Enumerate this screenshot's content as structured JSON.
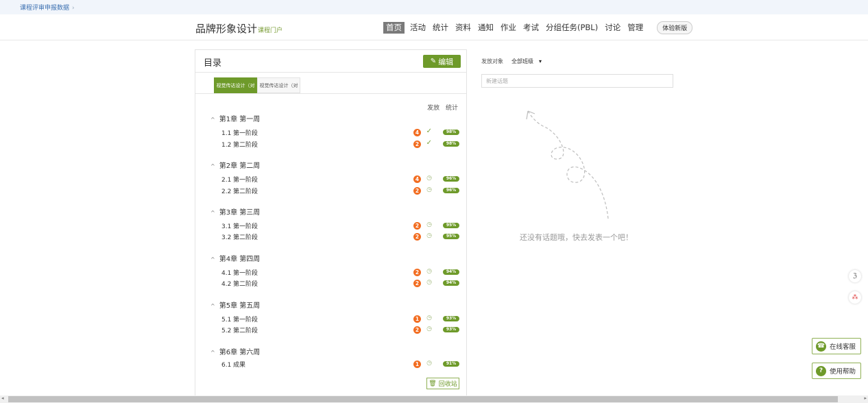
{
  "breadcrumb": {
    "label": "课程评审申报数据",
    "chevron": "›"
  },
  "header": {
    "course_title": "品牌形象设计",
    "portal_link": "课程门户",
    "nav": [
      {
        "label": "首页",
        "active": true
      },
      {
        "label": "活动"
      },
      {
        "label": "统计"
      },
      {
        "label": "资料"
      },
      {
        "label": "通知"
      },
      {
        "label": "作业"
      },
      {
        "label": "考试"
      },
      {
        "label": "分组任务(PBL)"
      },
      {
        "label": "讨论"
      },
      {
        "label": "管理"
      }
    ],
    "new_version": "体验新版"
  },
  "catalog": {
    "title": "目录",
    "edit_label": "编辑",
    "tabs": [
      "视觉传达设计（对",
      "视觉传达设计（对"
    ],
    "col_publish": "发放",
    "col_stats": "统计",
    "chapters": [
      {
        "title": "第1章 第一周",
        "sections": [
          {
            "num": "1.1",
            "name": "第一阶段",
            "badge": "4",
            "status": "check",
            "pct": "98%"
          },
          {
            "num": "1.2",
            "name": "第二阶段",
            "badge": "2",
            "status": "check",
            "pct": "98%"
          }
        ]
      },
      {
        "title": "第2章 第二周",
        "sections": [
          {
            "num": "2.1",
            "name": "第一阶段",
            "badge": "4",
            "status": "clock",
            "pct": "96%"
          },
          {
            "num": "2.2",
            "name": "第二阶段",
            "badge": "2",
            "status": "clock",
            "pct": "96%"
          }
        ]
      },
      {
        "title": "第3章 第三周",
        "sections": [
          {
            "num": "3.1",
            "name": "第一阶段",
            "badge": "2",
            "status": "clock",
            "pct": "95%"
          },
          {
            "num": "3.2",
            "name": "第二阶段",
            "badge": "2",
            "status": "clock",
            "pct": "95%"
          }
        ]
      },
      {
        "title": "第4章 第四周",
        "sections": [
          {
            "num": "4.1",
            "name": "第一阶段",
            "badge": "2",
            "status": "clock",
            "pct": "94%"
          },
          {
            "num": "4.2",
            "name": "第二阶段",
            "badge": "2",
            "status": "clock",
            "pct": "94%"
          }
        ]
      },
      {
        "title": "第5章 第五周",
        "sections": [
          {
            "num": "5.1",
            "name": "第一阶段",
            "badge": "1",
            "status": "clock",
            "pct": "93%"
          },
          {
            "num": "5.2",
            "name": "第二阶段",
            "badge": "2",
            "status": "clock",
            "pct": "93%"
          }
        ]
      },
      {
        "title": "第6章 第六周",
        "sections": [
          {
            "num": "6.1",
            "name": "成果",
            "badge": "1",
            "status": "clock",
            "pct": "91%"
          }
        ]
      }
    ],
    "recycle_label": "回收站"
  },
  "discussion": {
    "target_label": "发放对象",
    "target_value": "全部班级",
    "new_topic_placeholder": "新建话题",
    "empty_text": "还没有话题哦，快去发表一个吧！"
  },
  "side_tools": {
    "translate_icon": "translate-icon",
    "network_icon": "network-icon"
  },
  "float_buttons": {
    "service": "在线客服",
    "help": "使用帮助"
  },
  "colors": {
    "accent": "#6e9a2a",
    "badge": "#f26d21",
    "link": "#3a6fb0"
  }
}
